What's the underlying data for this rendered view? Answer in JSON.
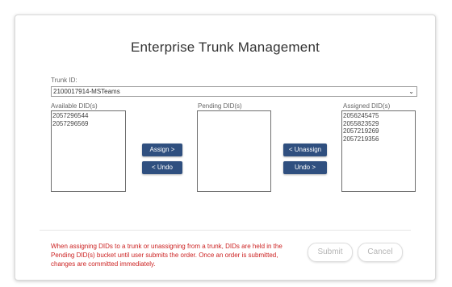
{
  "page": {
    "title": "Enterprise Trunk Management"
  },
  "trunk": {
    "label": "Trunk ID:",
    "selected": "2100017914-MSTeams"
  },
  "available": {
    "label": "Available DID(s)",
    "items": [
      "2057296544",
      "2057296569"
    ]
  },
  "pending": {
    "label": "Pending DID(s)",
    "items": []
  },
  "assigned": {
    "label": "Assigned DID(s)",
    "items": [
      "2056245475",
      "2055823529",
      "2057219269",
      "2057219356"
    ]
  },
  "buttons": {
    "assign": "Assign >",
    "undo_left": "< Undo",
    "unassign": "< Unassign",
    "undo_right": "Undo >",
    "submit": "Submit",
    "cancel": "Cancel"
  },
  "note": "When assigning DIDs to a trunk or unassigning from a trunk, DIDs are held in the Pending DID(s) bucket until user submits the order. Once an order is submitted, changes are committed immediately.",
  "colors": {
    "primary_button": "#2f4f7f",
    "note_text": "#cc2222"
  }
}
